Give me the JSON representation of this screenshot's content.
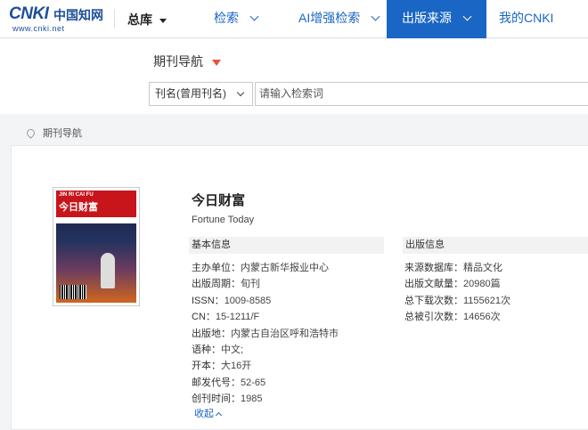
{
  "logo": {
    "brand": "CNKI",
    "cn": "中国知网",
    "url": "www.cnki.net"
  },
  "header": {
    "db_switch": "总库",
    "nav": [
      {
        "label": "检索"
      },
      {
        "label": "AI增强检索"
      },
      {
        "label": "出版来源"
      },
      {
        "label": "我的CNKI"
      }
    ],
    "accent": "#1a66c4"
  },
  "search": {
    "section_title": "期刊导航",
    "field_select": "刊名(曾用刊名)",
    "placeholder": "请输入检索词"
  },
  "breadcrumb": "期刊导航",
  "journal": {
    "title": "今日财富",
    "english_title": "Fortune Today",
    "cover": {
      "pinyin": "JIN RI CAI FU",
      "title": "今日财富"
    },
    "basic_info_heading": "基本信息",
    "basic_info": [
      {
        "label": "主办单位：",
        "value": "内蒙古新华报业中心"
      },
      {
        "label": "出版周期：",
        "value": "旬刊"
      },
      {
        "label": "ISSN：",
        "value": "1009-8585"
      },
      {
        "label": "CN：",
        "value": "15-1211/F"
      },
      {
        "label": "出版地：",
        "value": "内蒙古自治区呼和浩特市"
      },
      {
        "label": "语种：",
        "value": "中文;"
      },
      {
        "label": "开本：",
        "value": "大16开"
      },
      {
        "label": "邮发代号：",
        "value": "52-65"
      },
      {
        "label": "创刊时间：",
        "value": "1985"
      }
    ],
    "pub_info_heading": "出版信息",
    "pub_info": [
      {
        "label": "来源数据库：",
        "value": "精品文化"
      },
      {
        "label": "出版文献量：",
        "value": "20980篇"
      },
      {
        "label": "总下载次数：",
        "value": "1155621次"
      },
      {
        "label": "总被引次数：",
        "value": "14656次"
      }
    ],
    "collapse_label": "收起"
  }
}
